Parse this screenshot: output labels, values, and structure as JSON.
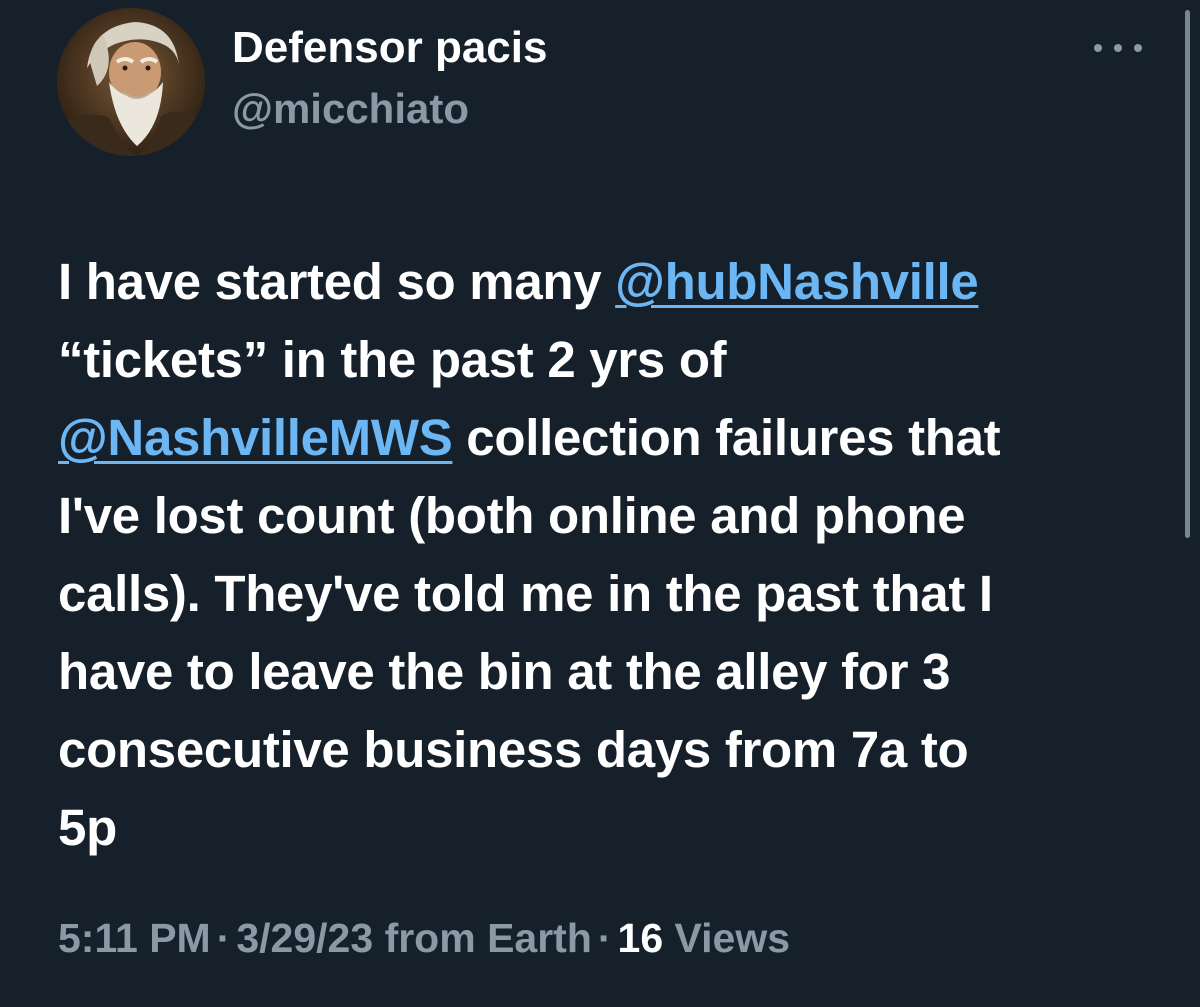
{
  "author": {
    "display_name": "Defensor pacis",
    "handle": "@micchiato",
    "avatar_icon": "bearded-man-portrait"
  },
  "more_icon": "more-horizontal-icon",
  "tweet": {
    "lines": [
      [
        {
          "text": "I have started so many "
        },
        {
          "text": "@hubNashville",
          "mention": true
        }
      ],
      [
        {
          "text": "“tickets” in the past 2 yrs of"
        }
      ],
      [
        {
          "text": "@NashvilleMWS",
          "mention": true
        },
        {
          "text": " collection failures that"
        }
      ],
      [
        {
          "text": "I've lost count (both online and phone"
        }
      ],
      [
        {
          "text": "calls). They've told me in the past that I"
        }
      ],
      [
        {
          "text": "have to leave the bin at the alley for 3"
        }
      ],
      [
        {
          "text": "consecutive business days from 7a to"
        }
      ],
      [
        {
          "text": "5p"
        }
      ]
    ]
  },
  "meta": {
    "time": "5:11 PM",
    "date": "3/29/23",
    "source": "from Earth",
    "views_count": "16",
    "views_label": "Views",
    "separator": "·"
  },
  "colors": {
    "background": "#15202b",
    "text": "#ffffff",
    "secondary_text": "#8b98a5",
    "link": "#6cb6f4"
  }
}
